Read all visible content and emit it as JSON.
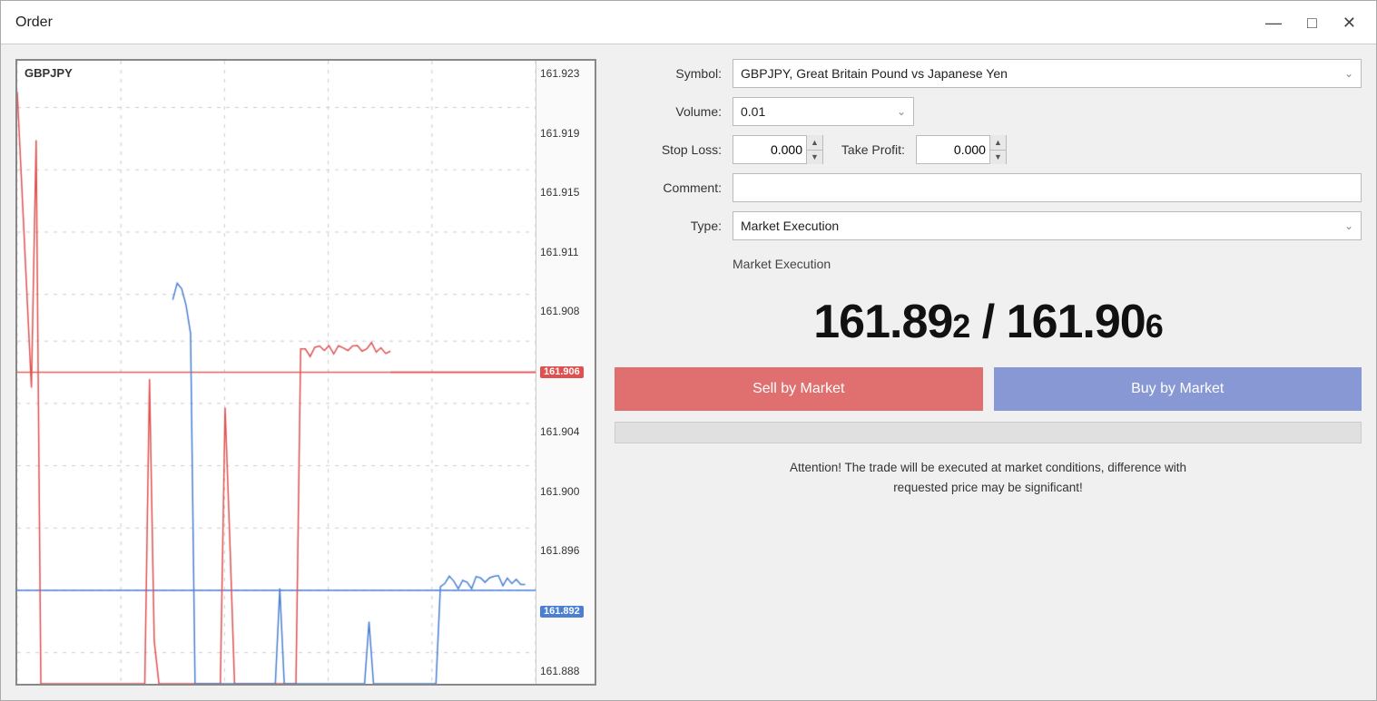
{
  "window": {
    "title": "Order",
    "controls": {
      "minimize": "—",
      "maximize": "□",
      "close": "✕"
    }
  },
  "chart": {
    "symbol_label": "GBPJPY",
    "y_labels": [
      "161.923",
      "161.919",
      "161.915",
      "161.911",
      "161.908",
      "161.906",
      "161.904",
      "161.900",
      "161.896",
      "161.892",
      "161.888"
    ],
    "bid_price": "161.892",
    "ask_price": "161.906"
  },
  "form": {
    "symbol_label": "Symbol:",
    "symbol_value": "GBPJPY, Great Britain Pound vs Japanese Yen",
    "volume_label": "Volume:",
    "volume_value": "0.01",
    "stop_loss_label": "Stop Loss:",
    "stop_loss_value": "0.000",
    "take_profit_label": "Take Profit:",
    "take_profit_value": "0.000",
    "comment_label": "Comment:",
    "comment_value": "",
    "type_label": "Type:",
    "type_value": "Market Execution"
  },
  "execution": {
    "header": "Market Execution",
    "bid": "161.892",
    "bid_suffix": "2",
    "ask": "161.906",
    "ask_suffix": "6",
    "separator": " / ",
    "price_display": "161.892 / 161.906"
  },
  "buttons": {
    "sell": "Sell by Market",
    "buy": "Buy by Market"
  },
  "attention": {
    "text": "Attention! The trade will be executed at market conditions, difference with\nrequested price may be significant!"
  }
}
